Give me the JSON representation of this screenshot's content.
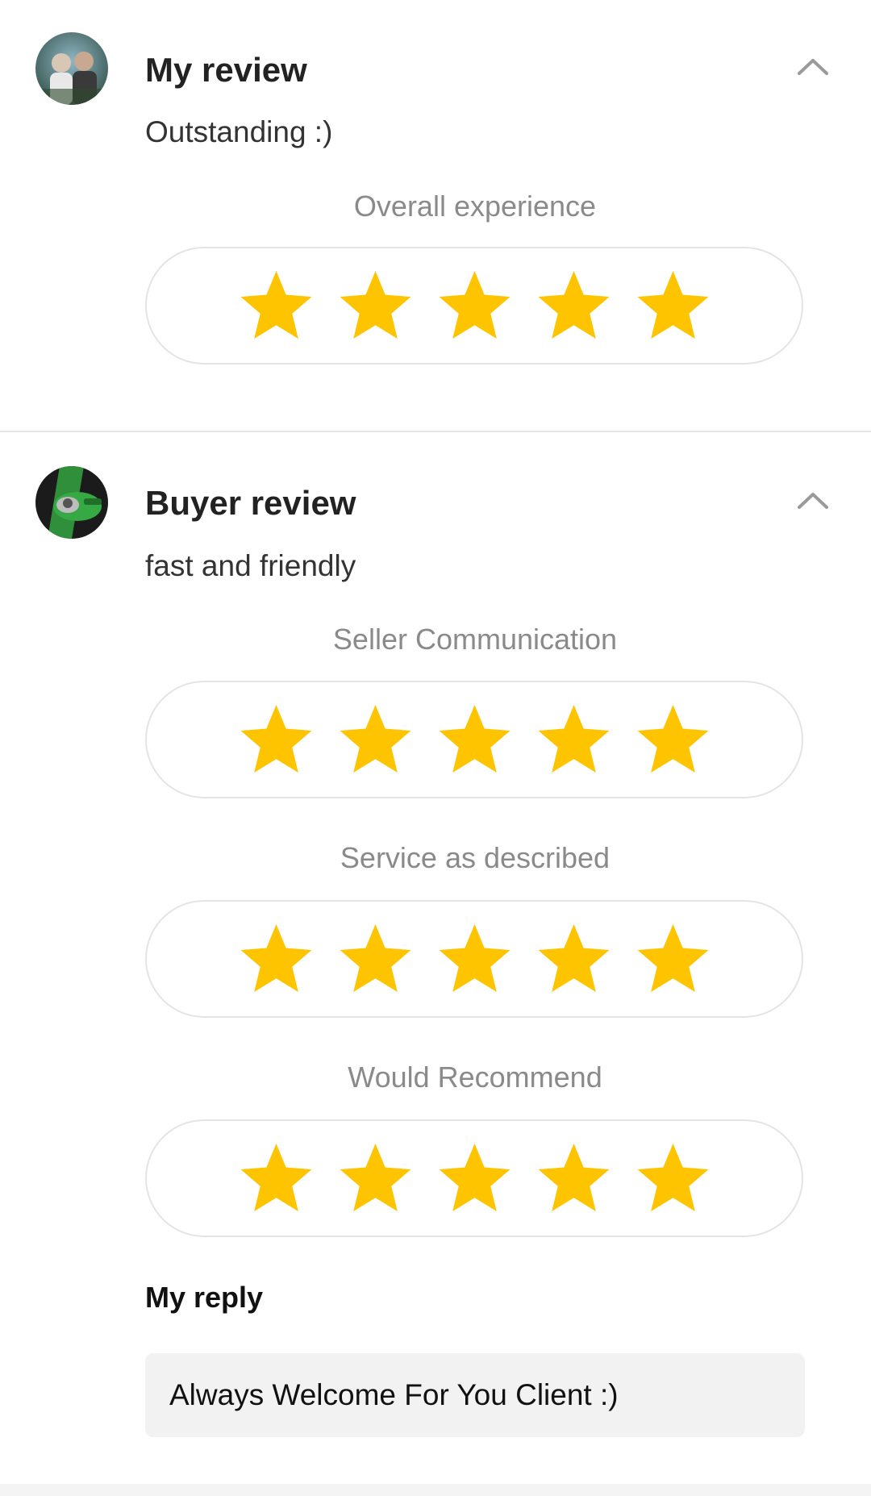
{
  "my_review": {
    "title": "My review",
    "text": "Outstanding :)",
    "ratings": [
      {
        "label": "Overall experience",
        "stars": 5,
        "max": 5
      }
    ],
    "avatar": "user-photo-avatar",
    "expanded_icon": "chevron-up-icon"
  },
  "buyer_review": {
    "title": "Buyer review",
    "text": "fast and friendly",
    "ratings": [
      {
        "label": "Seller Communication",
        "stars": 5,
        "max": 5
      },
      {
        "label": "Service as described",
        "stars": 5,
        "max": 5
      },
      {
        "label": "Would Recommend",
        "stars": 5,
        "max": 5
      }
    ],
    "avatar": "buyer-photo-avatar",
    "expanded_icon": "chevron-up-icon"
  },
  "reply": {
    "title": "My reply",
    "text": "Always Welcome For You Client :)"
  },
  "colors": {
    "star": "#FFC400",
    "label": "#8a8a8a",
    "pill_border": "#e4e4e4",
    "reply_bg": "#f2f2f2"
  }
}
